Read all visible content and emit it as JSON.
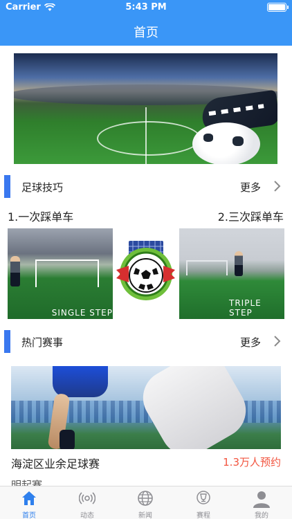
{
  "status_bar": {
    "carrier": "Carrier",
    "time": "5:43 PM"
  },
  "header": {
    "title": "首页"
  },
  "banner": {
    "image": "stadium-soccer-banner"
  },
  "skills_section": {
    "label": "足球技巧",
    "more": "更多",
    "items": [
      {
        "title": "1.一次踩单车",
        "caption": "SINGLE STEP"
      },
      {
        "title": "2.三次踩单车",
        "caption": "TRIPLE STEP"
      }
    ]
  },
  "events_section": {
    "label": "热门赛事",
    "more": "更多"
  },
  "match": {
    "name": "海淀区业余足球赛",
    "signup": "1.3万人预约"
  },
  "next_item": "明起赛",
  "tabbar": {
    "items": [
      {
        "label": "首页",
        "icon": "home-icon",
        "active": true
      },
      {
        "label": "动态",
        "icon": "broadcast-icon",
        "active": false
      },
      {
        "label": "新闻",
        "icon": "globe-icon",
        "active": false
      },
      {
        "label": "赛程",
        "icon": "trophy-icon",
        "active": false
      },
      {
        "label": "我的",
        "icon": "person-icon",
        "active": false
      }
    ]
  },
  "colors": {
    "accent": "#3a96f7",
    "section_bar": "#3a78ef",
    "signup": "#f2543f",
    "tab_active": "#2f80ed"
  }
}
